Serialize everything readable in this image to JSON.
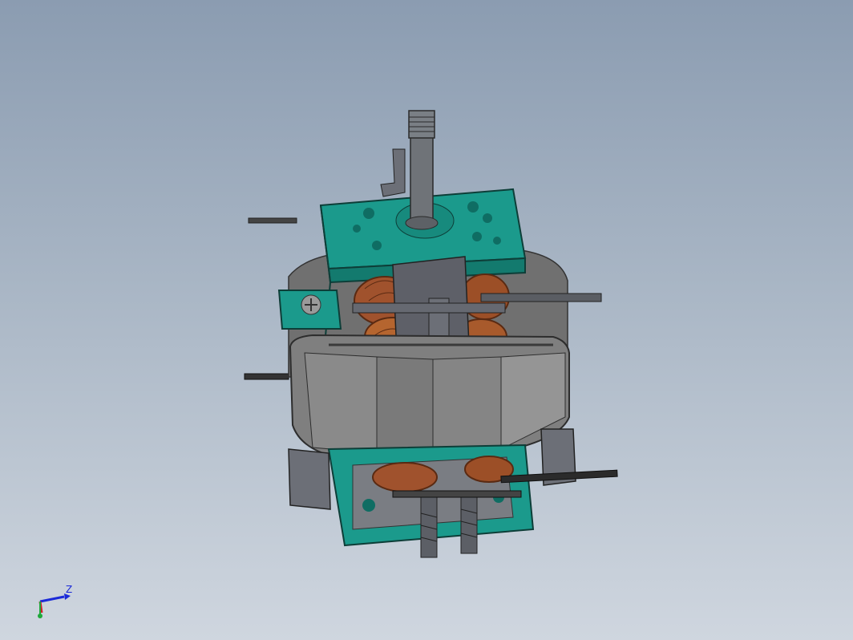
{
  "view": {
    "type": "3D CAD model viewport",
    "background_top": "#8b9cb1",
    "background_bottom": "#cfd6df"
  },
  "model": {
    "description_icon": "universal-motor-assembly",
    "colors": {
      "bracket": "#1b9a8c",
      "stator": "#8c8c8c",
      "winding": "#a0522d",
      "shaft": "#6f7378",
      "wire": "#2b2b2b"
    }
  },
  "triad": {
    "axis_label": "Z",
    "colors": {
      "z": "#1b2ad8",
      "x": "#d0202a",
      "y": "#1fa83a"
    }
  }
}
